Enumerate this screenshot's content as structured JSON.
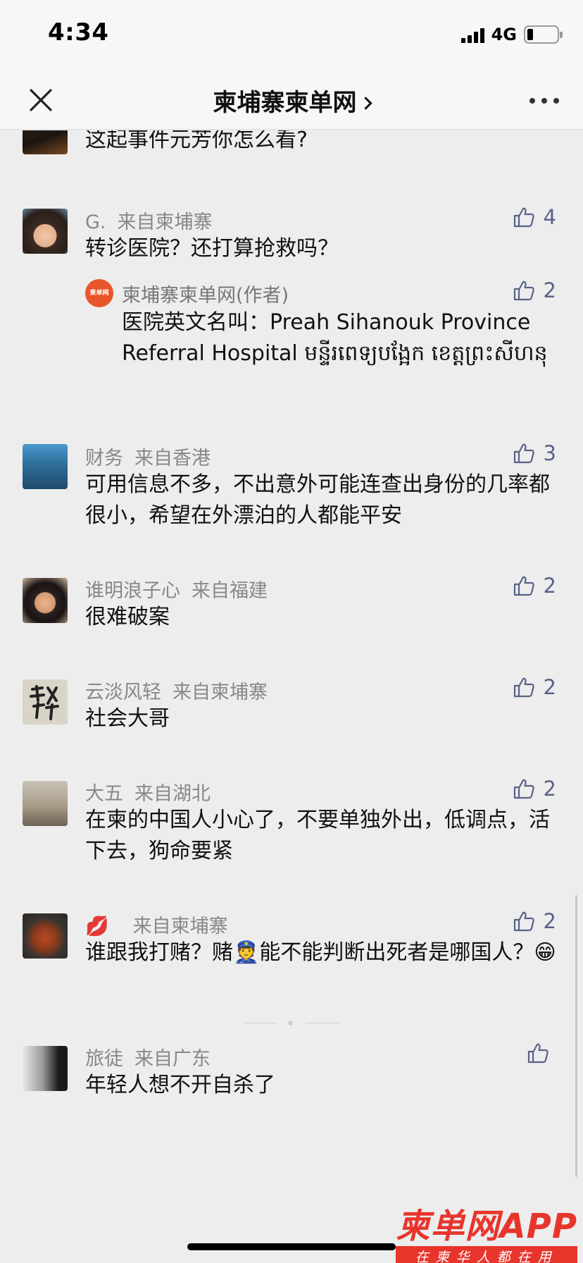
{
  "status_bar": {
    "time": "4:34",
    "network": "4G",
    "battery_level": 0.2
  },
  "nav": {
    "title": "柬埔寨柬单网",
    "close_icon": "close-icon",
    "more_icon": "more-icon"
  },
  "comments": [
    {
      "content": "这起事件元芳你怎么看?"
    },
    {
      "name": "G.",
      "from": "来自柬埔寨",
      "content": "转诊医院？还打算抢救吗？",
      "likes": "4",
      "reply": {
        "avatar_text": "柬单网",
        "name": "柬埔寨柬单网(作者)",
        "content": "医院英文名叫：Preah Sihanouk Province Referral Hospital មន្ទីរពេទ្យបង្អែក ខេត្តព្រះសីហនុ",
        "likes": "2"
      }
    },
    {
      "name": "财务",
      "from": "来自香港",
      "content": "可用信息不多，不出意外可能连查出身份的几率都很小，希望在外漂泊的人都能平安",
      "likes": "3"
    },
    {
      "name": "谁明浪子心",
      "from": "来自福建",
      "content": "很难破案",
      "likes": "2"
    },
    {
      "name": "云淡风轻",
      "from": "来自柬埔寨",
      "content": "社会大哥",
      "likes": "2"
    },
    {
      "name": "大五",
      "from": "来自湖北",
      "content": "在柬的中国人小心了，不要单独外出，低调点，活下去，狗命要紧",
      "likes": "2"
    },
    {
      "name": "💋",
      "from": "来自柬埔寨",
      "content": "谁跟我打赌？赌👮能不能判断出死者是哪国人？😁",
      "likes": "2"
    },
    {
      "name": "旅徒",
      "from": "来自广东",
      "content": "年轻人想不开自杀了",
      "likes": ""
    }
  ],
  "watermark": {
    "main": "柬单网APP",
    "sub": "在柬华人都在用"
  }
}
